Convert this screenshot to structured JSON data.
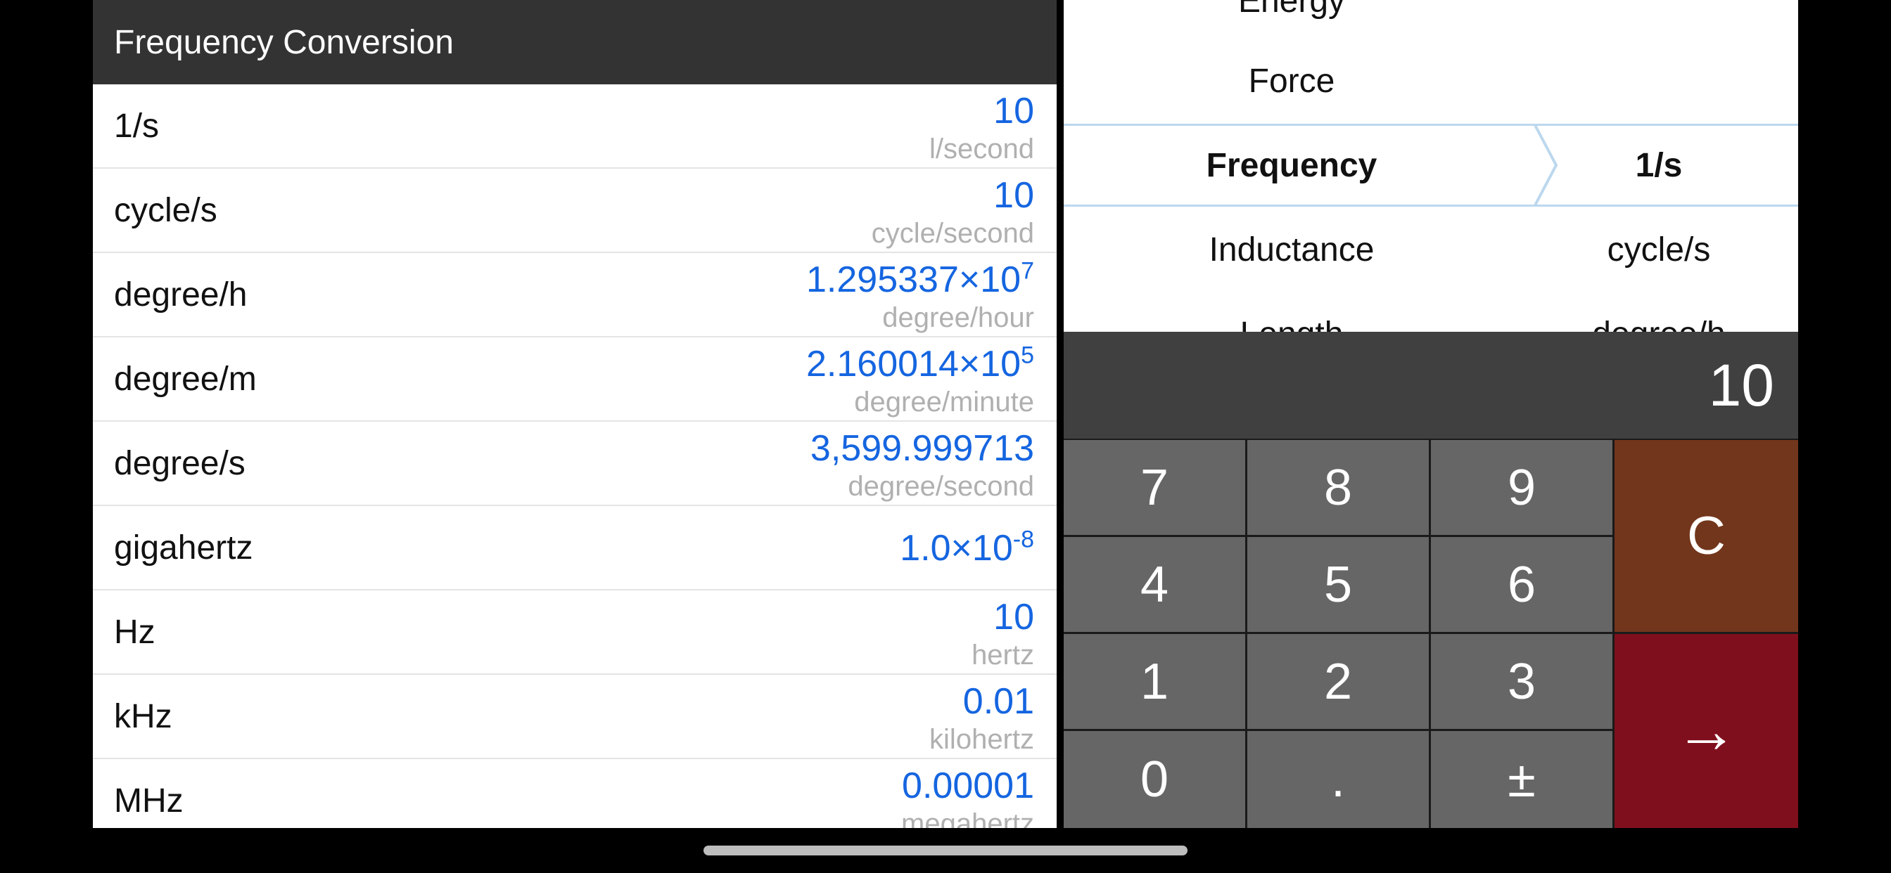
{
  "header": {
    "title": "Frequency Conversion"
  },
  "rows": [
    {
      "label": "1/s",
      "value": "10",
      "unit": "l/second"
    },
    {
      "label": "cycle/s",
      "value": "10",
      "unit": "cycle/second"
    },
    {
      "label": "degree/h",
      "mantissa": "1.295337×10",
      "exp": "7",
      "unit": "degree/hour"
    },
    {
      "label": "degree/m",
      "mantissa": "2.160014×10",
      "exp": "5",
      "unit": "degree/minute"
    },
    {
      "label": "degree/s",
      "value": "3,599.999713",
      "unit": "degree/second"
    },
    {
      "label": "gigahertz",
      "mantissa": "1.0×10",
      "exp": "-8"
    },
    {
      "label": "Hz",
      "value": "10",
      "unit": "hertz"
    },
    {
      "label": "kHz",
      "value": "0.01",
      "unit": "kilohertz"
    },
    {
      "label": "MHz",
      "value": "0.00001",
      "unit": "megahertz"
    }
  ],
  "picker": {
    "categories": [
      "Energy",
      "Force",
      "Frequency",
      "Inductance",
      "Length"
    ],
    "units": [
      "1/s",
      "cycle/s",
      "degree/h"
    ],
    "selected_category": "Frequency",
    "selected_unit": "1/s"
  },
  "display": {
    "value": "10"
  },
  "keypad": {
    "k7": "7",
    "k8": "8",
    "k9": "9",
    "k4": "4",
    "k5": "5",
    "k6": "6",
    "k1": "1",
    "k2": "2",
    "k3": "3",
    "k0": "0",
    "dot": ".",
    "sign": "±",
    "clear": "C",
    "go": "→"
  },
  "colors": {
    "accent_blue": "#1565e0",
    "clear_key": "#72361c",
    "go_key": "#800f1d",
    "header": "#333333"
  }
}
